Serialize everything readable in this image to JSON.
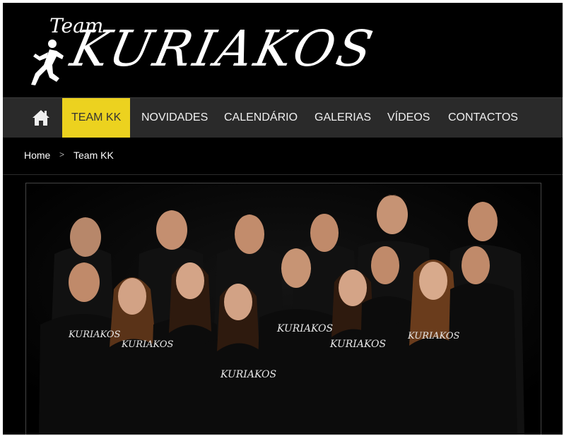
{
  "logo": {
    "team_text": "Team",
    "brand_text": "KURIAKOS"
  },
  "nav": {
    "home_icon": "home-icon",
    "items": [
      {
        "label": "TEAM KK",
        "active": true
      },
      {
        "label": "NOVIDADES"
      },
      {
        "label": "CALENDÁRIO"
      },
      {
        "label": "GALERIAS"
      },
      {
        "label": "VÍDEOS"
      },
      {
        "label": "CONTACTOS"
      }
    ]
  },
  "breadcrumb": {
    "home": "Home",
    "separator": ">",
    "current": "Team KK"
  },
  "photo": {
    "shirt_text": "KURIAKOS"
  },
  "colors": {
    "accent": "#ecd21f",
    "nav_bg": "#2a2a2a",
    "page_bg": "#000000"
  }
}
